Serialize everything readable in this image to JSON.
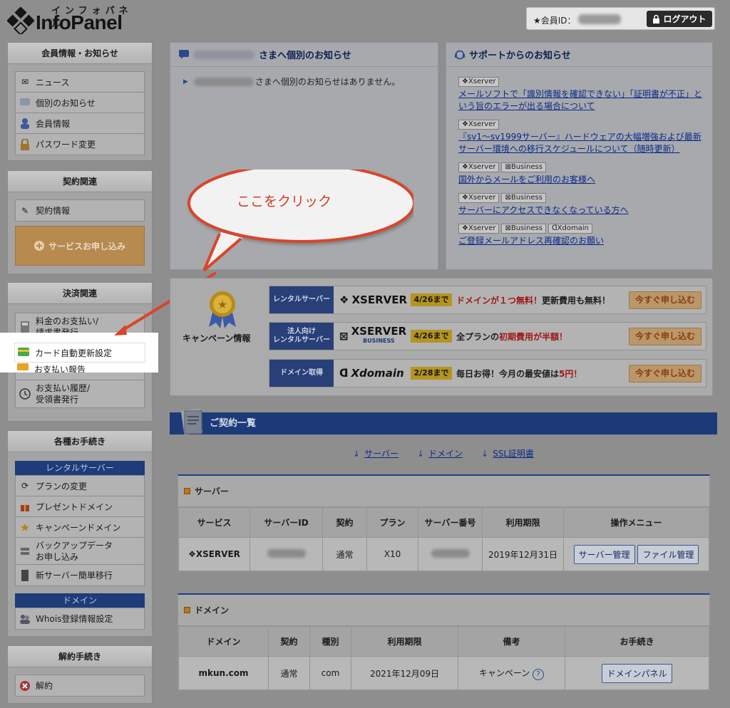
{
  "header": {
    "logo_kana": "インフォパネル",
    "logo_name": "InfoPanel",
    "member_label": "★会員ID：",
    "logout_label": "ログアウト"
  },
  "sidebar": {
    "member": {
      "title": "会員情報・お知らせ",
      "items": [
        "ニュース",
        "個別のお知らせ",
        "会員情報",
        "パスワード変更"
      ]
    },
    "contract": {
      "title": "契約関連",
      "items": [
        "契約情報"
      ],
      "order_button": "サービスお申し込み"
    },
    "payment": {
      "title": "決済関連",
      "items": [
        "料金のお支払い/",
        "請求書発行",
        "カード自動更新設定",
        "お支払い報告",
        "お支払い履歴/",
        "受領書発行"
      ]
    },
    "procedures": {
      "title": "各種お手続き",
      "rental_head": "レンタルサーバー",
      "rental_items": [
        "プランの変更",
        "プレゼントドメイン",
        "キャンペーンドメイン",
        "バックアップデータ",
        "お申し込み",
        "新サーバー簡単移行"
      ],
      "domain_head": "ドメイン",
      "domain_items": [
        "Whois登録情報設定"
      ]
    },
    "cancel": {
      "title": "解約手続き",
      "items": [
        "解約"
      ]
    }
  },
  "personal": {
    "title_suffix": "さまへ個別のお知らせ",
    "message_suffix": "さまへ個別のお知らせはありません。"
  },
  "support": {
    "title": "サポートからのお知らせ",
    "news": [
      {
        "tags": [
          "❖Xserver"
        ],
        "lines": [
          "メールソフトで「識別情報を確認できない」「証明書が不正」と",
          "いう旨のエラーが出る場合について"
        ]
      },
      {
        "tags": [
          "❖Xserver"
        ],
        "lines": [
          "『sv1～sv1999サーバー』ハードウェアの大幅増強および最新",
          "サーバー環境への移行スケジュールについて（随時更新）"
        ]
      },
      {
        "tags": [
          "❖Xserver",
          "⊠Business"
        ],
        "lines": [
          "国外からメールをご利用のお客様へ"
        ]
      },
      {
        "tags": [
          "❖Xserver",
          "⊠Business"
        ],
        "lines": [
          "サーバーにアクセスできなくなっている方へ"
        ]
      },
      {
        "tags": [
          "❖Xserver",
          "⊠Business",
          "ᗡXdomain"
        ],
        "lines": [
          "ご登録メールアドレス再確認のお願い"
        ]
      }
    ]
  },
  "callout": {
    "text": "ここをクリック"
  },
  "campaign": {
    "label": "キャンペーン情報",
    "rows": [
      {
        "label": "レンタルサーバー",
        "brand": "XSERVER",
        "brand_sub": "",
        "date": "4/26まで",
        "pre": "ドメインが１つ無料！",
        "post": "更新費用も無料！",
        "button": "今すぐ申し込む"
      },
      {
        "label": "法人向け\nレンタルサーバー",
        "brand": "XSERVER",
        "brand_sub": "BUSINESS",
        "date": "4/26まで",
        "pre": "全プランの",
        "hl": "初期費用が半額！",
        "button": "今すぐ申し込む"
      },
      {
        "label": "ドメイン取得",
        "brand": "Xdomain",
        "brand_sub": "",
        "date": "2/28まで",
        "pre": "毎日お得！今月の最安値は",
        "hl": "5円！",
        "button": "今すぐ申し込む"
      }
    ]
  },
  "contracts": {
    "title": "ご契約一覧",
    "anchors": [
      "サーバー",
      "ドメイン",
      "SSL証明書"
    ],
    "server": {
      "title": "サーバー",
      "headers": [
        "サービス",
        "サーバーID",
        "契約",
        "プラン",
        "サーバー番号",
        "利用期限",
        "操作メニュー"
      ],
      "row": {
        "service": "XSERVER",
        "contract": "通常",
        "plan": "X10",
        "expiry": "2019年12月31日",
        "btn1": "サーバー管理",
        "btn2": "ファイル管理"
      }
    },
    "domain": {
      "title": "ドメイン",
      "headers": [
        "ドメイン",
        "契約",
        "種別",
        "利用期限",
        "備考",
        "お手続き"
      ],
      "row": {
        "domain": "mkun.com",
        "contract": "通常",
        "type": "com",
        "expiry": "2021年12月09日",
        "note": "キャンペーン",
        "btn": "ドメインパネル"
      }
    }
  }
}
